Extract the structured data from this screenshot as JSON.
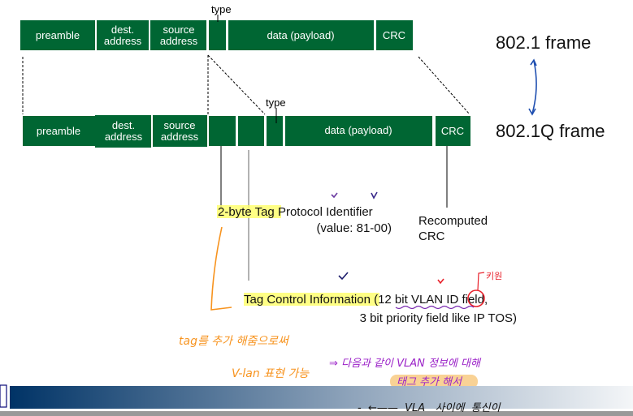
{
  "frame_8021": {
    "title": "802.1 frame",
    "fields": [
      "preamble",
      "dest.|address",
      "source|address",
      "",
      "data (payload)",
      "CRC"
    ],
    "type_label": "type"
  },
  "frame_8021q": {
    "title": "802.1Q frame",
    "fields": [
      "preamble",
      "dest.|address",
      "source|address",
      "",
      "",
      "",
      "data (payload)",
      "CRC"
    ],
    "type_label": "type"
  },
  "annotations": {
    "tpid_line1_hl": "2-byte Tag",
    "tpid_line1_rest": " Protocol Identifier",
    "tpid_line2": "(value: 81-00)",
    "crc_line1": "Recomputed",
    "crc_line2": "CRC",
    "tci_line1_hl": "Tag Control Information",
    "tci_line1_rest": " (12 bit VLAN ID field,",
    "tci_line2": "3 bit priority field like IP TOS)"
  },
  "handwriting": {
    "orange_1": "tag를 추가 해줌으로써",
    "orange_2": "V-lan 표현 가능",
    "purple_1": "⇒ 다음과 같이 VLAN 정보에 대해",
    "purple_2": "태그 추가 해서",
    "red_note": "키원",
    "black_1": "-  ←——  VLA   사이에  통신이"
  },
  "colors": {
    "field_green": "#006633",
    "highlight": "#ffff66",
    "orange_ink": "#f7931e",
    "purple_ink": "#9b22c8",
    "red_ink": "#e8202a",
    "arrow_blue": "#1f4fb0",
    "footer_navy": "#003366"
  }
}
